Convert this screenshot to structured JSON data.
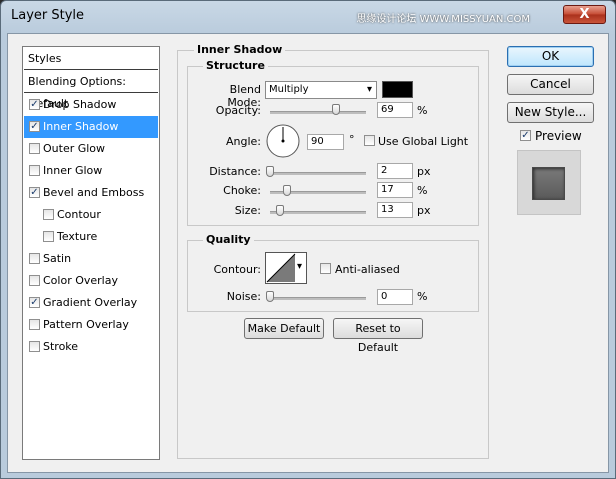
{
  "window": {
    "title": "Layer Style",
    "close_glyph": "X",
    "watermark": "思缘设计论坛 WWW.MISSYUAN.COM"
  },
  "sidebar": {
    "header": "Styles",
    "blending": "Blending Options: Default",
    "items": [
      {
        "label": "Drop Shadow",
        "checked": true
      },
      {
        "label": "Inner Shadow",
        "checked": true,
        "selected": true
      },
      {
        "label": "Outer Glow",
        "checked": false
      },
      {
        "label": "Inner Glow",
        "checked": false
      },
      {
        "label": "Bevel and Emboss",
        "checked": true
      },
      {
        "label": "Contour",
        "checked": false,
        "indent": true
      },
      {
        "label": "Texture",
        "checked": false,
        "indent": true
      },
      {
        "label": "Satin",
        "checked": false
      },
      {
        "label": "Color Overlay",
        "checked": false
      },
      {
        "label": "Gradient Overlay",
        "checked": true
      },
      {
        "label": "Pattern Overlay",
        "checked": false
      },
      {
        "label": "Stroke",
        "checked": false
      }
    ]
  },
  "panel": {
    "title": "Inner Shadow",
    "structure": {
      "title": "Structure",
      "blend_mode_label": "Blend Mode:",
      "blend_mode_value": "Multiply",
      "blend_color": "#000000",
      "opacity_label": "Opacity:",
      "opacity_value": "69",
      "opacity_unit": "%",
      "opacity_fraction": 0.69,
      "angle_label": "Angle:",
      "angle_value": "90",
      "angle_unit": "°",
      "global_light_label": "Use Global Light",
      "global_light_checked": false,
      "distance_label": "Distance:",
      "distance_value": "2",
      "distance_unit": "px",
      "choke_label": "Choke:",
      "choke_value": "17",
      "choke_unit": "%",
      "size_label": "Size:",
      "size_value": "13",
      "size_unit": "px"
    },
    "quality": {
      "title": "Quality",
      "contour_label": "Contour:",
      "anti_aliased_label": "Anti-aliased",
      "anti_aliased_checked": false,
      "noise_label": "Noise:",
      "noise_value": "0",
      "noise_unit": "%"
    },
    "make_default": "Make Default",
    "reset_default": "Reset to Default"
  },
  "actions": {
    "ok": "OK",
    "cancel": "Cancel",
    "new_style": "New Style...",
    "preview_label": "Preview",
    "preview_checked": true
  },
  "icons": [
    "close-icon",
    "checkmark-icon",
    "dropdown-arrow-icon",
    "angle-dial-icon",
    "contour-curve-icon",
    "color-swatch",
    "slider-thumb-icon"
  ]
}
